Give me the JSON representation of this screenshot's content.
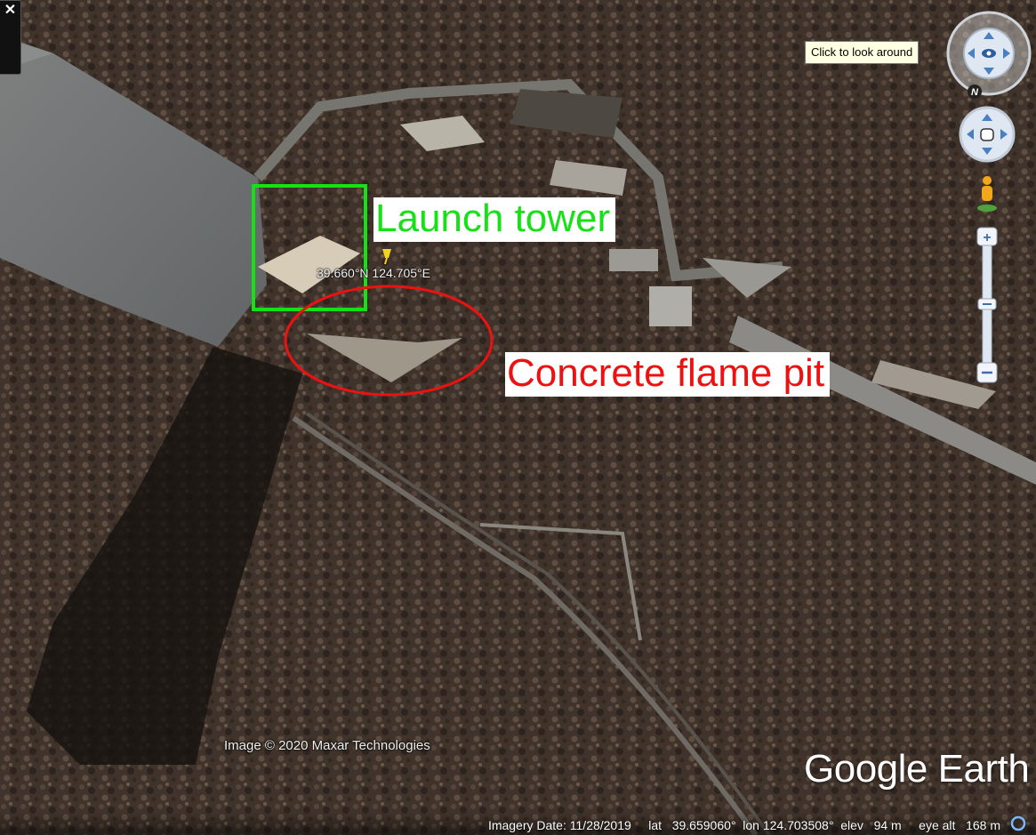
{
  "annotations": {
    "launch_tower": "Launch tower",
    "flame_pit": "Concrete flame pit",
    "launch_tower_color": "#16e016",
    "flame_pit_color": "#ee1111"
  },
  "placemark": {
    "coordinates": "39.660°N 124.705°E",
    "icon": "pushpin-icon"
  },
  "controls": {
    "close_label": "✕",
    "tooltip": "Click to look around",
    "compass_north": "N",
    "zoom_in": "+",
    "zoom_out": "−",
    "icons": [
      "look-around-icon",
      "hand-pan-icon",
      "street-view-pegman-icon",
      "zoom-slider"
    ]
  },
  "imagery_credit": "Image © 2020 Maxar Technologies",
  "brand": {
    "google": "Google",
    "earth": "Earth"
  },
  "status": {
    "imagery_date_label": "Imagery Date:",
    "imagery_date": "11/28/2019",
    "lat_label": "lat",
    "lat": "39.659060°",
    "lon_label": "lon",
    "lon": "124.703508°",
    "elev_label": "elev",
    "elev": "94 m",
    "eye_alt_label": "eye alt",
    "eye_alt": "168 m"
  }
}
